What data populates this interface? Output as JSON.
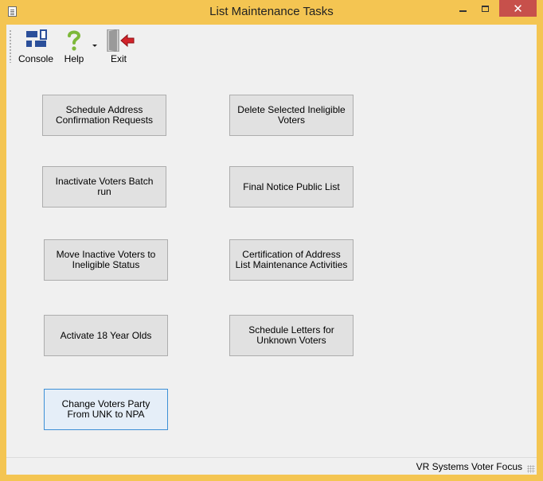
{
  "window": {
    "title": "List Maintenance Tasks",
    "close_glyph": "✕"
  },
  "toolbar": {
    "console_label": "Console",
    "help_label": "Help",
    "exit_label": "Exit"
  },
  "tasks": {
    "schedule_address": "Schedule Address Confirmation Requests",
    "delete_ineligible": "Delete Selected Ineligible Voters",
    "inactivate_batch": "Inactivate Voters Batch run",
    "final_notice": "Final Notice Public List",
    "move_inactive": "Move Inactive Voters to Ineligible Status",
    "certification": "Certification of Address List Maintenance Activities",
    "activate_18": "Activate 18 Year Olds",
    "schedule_letters": "Schedule Letters for Unknown Voters",
    "change_party": "Change Voters Party From UNK to NPA"
  },
  "status": {
    "text": "VR Systems Voter Focus"
  },
  "icons": {
    "title": "document-icon",
    "console": "console-icon",
    "help": "help-icon",
    "exit": "exit-door-icon"
  },
  "colors": {
    "frame": "#f4c552",
    "close_button": "#c7504b",
    "focus_border": "#3c8fd6"
  }
}
